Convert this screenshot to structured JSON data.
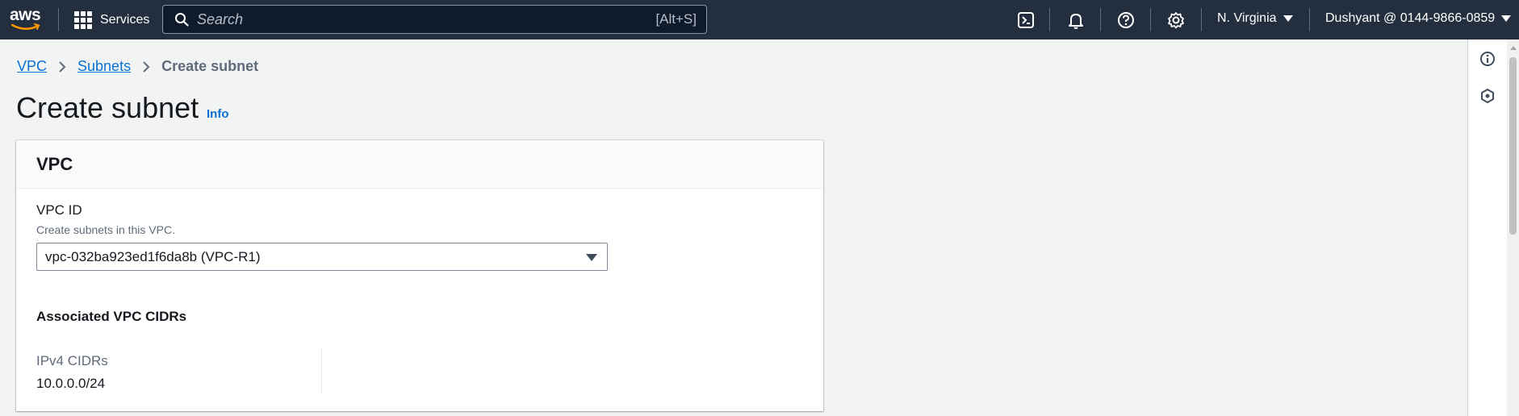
{
  "nav": {
    "logo_text": "aws",
    "services_label": "Services",
    "search_placeholder": "Search",
    "search_shortcut": "[Alt+S]",
    "region_label": "N. Virginia",
    "account_label": "Dushyant @ 0144-9866-0859",
    "icons": [
      "cloudshell-icon",
      "bell-icon",
      "help-icon",
      "gear-icon"
    ]
  },
  "breadcrumb": {
    "items": [
      {
        "label": "VPC"
      },
      {
        "label": "Subnets"
      }
    ],
    "current": "Create subnet"
  },
  "page": {
    "title": "Create subnet",
    "info_link": "Info"
  },
  "vpc_section": {
    "header": "VPC",
    "field_label": "VPC ID",
    "field_description": "Create subnets in this VPC.",
    "selected_vpc": "vpc-032ba923ed1f6da8b (VPC-R1)",
    "associated_title": "Associated VPC CIDRs",
    "ipv4_label": "IPv4 CIDRs",
    "ipv4_value": "10.0.0.0/24"
  },
  "colors": {
    "nav_bg": "#232f3e",
    "link": "#0972d3",
    "page_bg": "#f2f3f3",
    "aws_orange": "#ff9900"
  }
}
